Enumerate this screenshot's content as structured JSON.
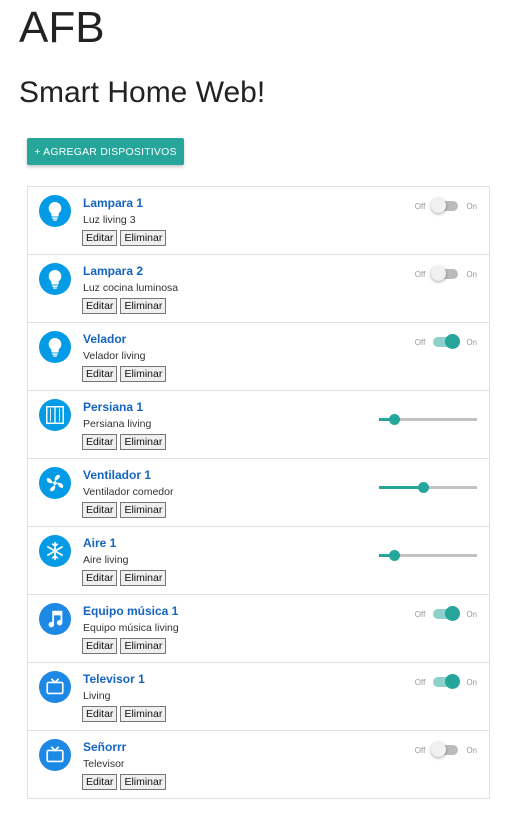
{
  "header": {
    "brand": "AFB",
    "title": "Smart Home Web!"
  },
  "add_button": "+ AGREGAR DISPOSITIVOS",
  "labels": {
    "edit": "Editar",
    "delete": "Eliminar",
    "off": "Off",
    "on": "On"
  },
  "devices": [
    {
      "name": "Lampara 1",
      "description": "Luz living 3",
      "icon": "lightbulb-icon",
      "control": "switch",
      "state": false
    },
    {
      "name": "Lampara 2",
      "description": "Luz cocina luminosa",
      "icon": "lightbulb-icon",
      "control": "switch",
      "state": false
    },
    {
      "name": "Velador",
      "description": "Velador living",
      "icon": "lightbulb-icon",
      "control": "switch",
      "state": true
    },
    {
      "name": "Persiana 1",
      "description": "Persiana living",
      "icon": "window-blind-icon",
      "control": "slider",
      "value": 0.15
    },
    {
      "name": "Ventilador 1",
      "description": "Ventilador comedor",
      "icon": "fan-icon",
      "control": "slider",
      "value": 0.45
    },
    {
      "name": "Aire 1",
      "description": "Aire living",
      "icon": "snowflake-icon",
      "control": "slider",
      "value": 0.15
    },
    {
      "name": "Equipo música 1",
      "description": "Equipo música living",
      "icon": "music-note-icon",
      "control": "switch",
      "state": true
    },
    {
      "name": "Televisor 1",
      "description": "Living",
      "icon": "tv-icon",
      "control": "switch",
      "state": true
    },
    {
      "name": "Señorrr",
      "description": "Televisor",
      "icon": "tv-icon",
      "control": "switch",
      "state": false
    }
  ],
  "colors": {
    "accent": "#26a69a",
    "link": "#1565c0",
    "icon_bg": "#039be5"
  }
}
